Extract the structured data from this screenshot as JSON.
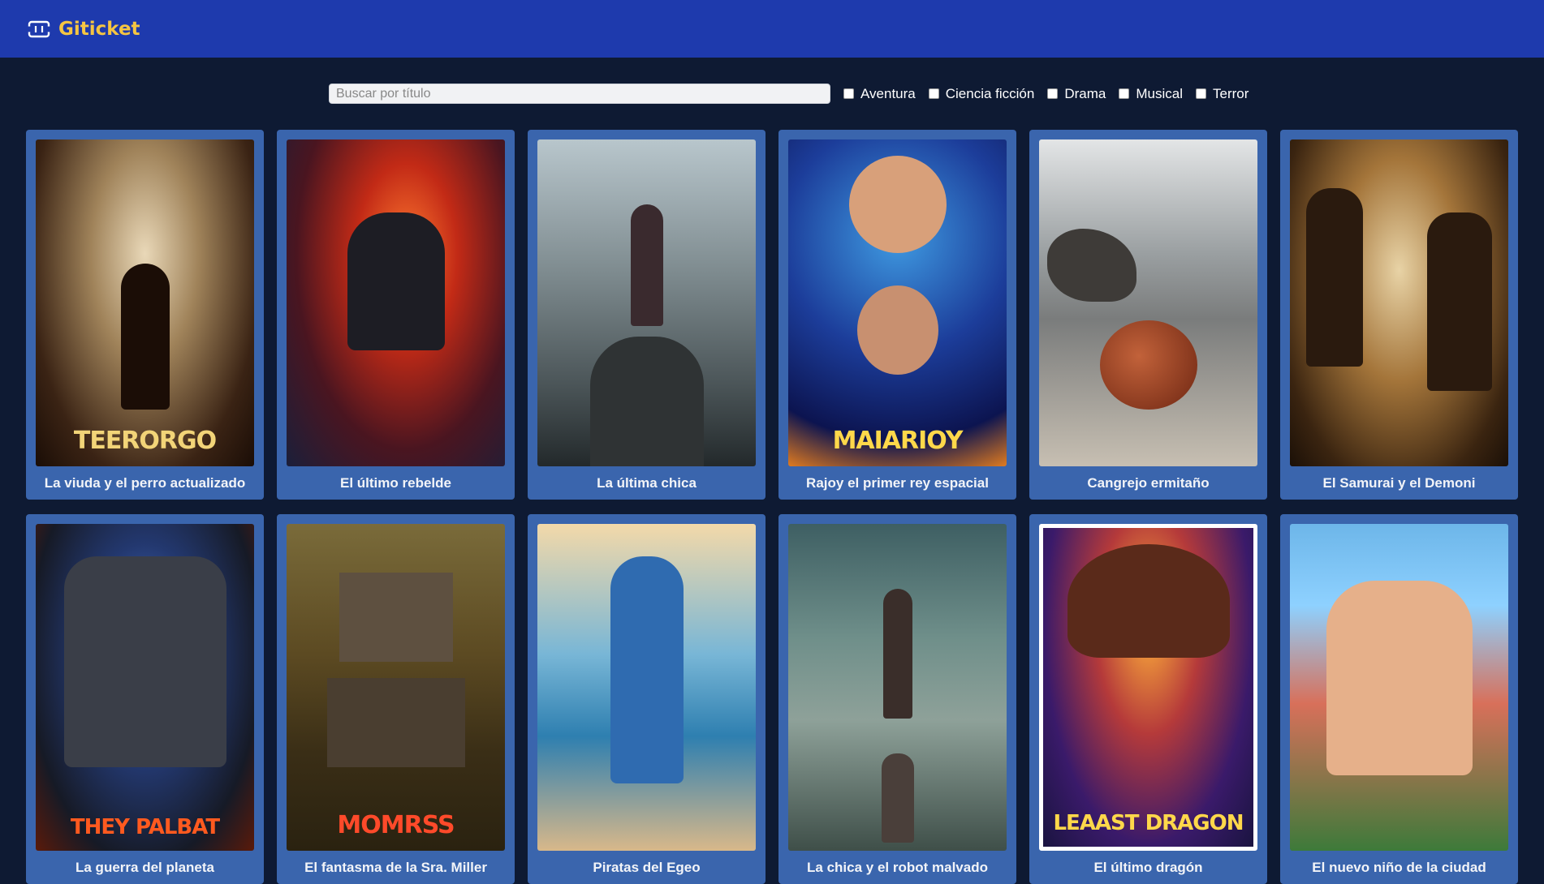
{
  "app": {
    "name": "Giticket"
  },
  "search": {
    "placeholder": "Buscar por título"
  },
  "genres": [
    "Aventura",
    "Ciencia ficción",
    "Drama",
    "Musical",
    "Terror"
  ],
  "movies": [
    {
      "title": "La viuda y el perro actualizado",
      "poster_text": "TEERORGO",
      "poster_text_color": "#f2d478"
    },
    {
      "title": "El último rebelde",
      "poster_text": "",
      "poster_text_color": "#ffffff"
    },
    {
      "title": "La última chica",
      "poster_text": "",
      "poster_text_color": "#ffffff"
    },
    {
      "title": "Rajoy el primer rey espacial",
      "poster_text": "MAIARIOY",
      "poster_text_color": "#ffd84a"
    },
    {
      "title": "Cangrejo ermitaño",
      "poster_text": "",
      "poster_text_color": "#ffffff"
    },
    {
      "title": "El Samurai y el Demoni",
      "poster_text": "",
      "poster_text_color": "#ffffff"
    },
    {
      "title": "La guerra del planeta",
      "poster_text": "THEY PALBAT",
      "poster_text_color": "#ff5a1f"
    },
    {
      "title": "El fantasma de la Sra. Miller",
      "poster_text": "MOMRSS",
      "poster_text_color": "#ff4a2a"
    },
    {
      "title": "Piratas del Egeo",
      "poster_text": "",
      "poster_text_color": "#ffffff"
    },
    {
      "title": "La chica y el robot malvado",
      "poster_text": "",
      "poster_text_color": "#ffffff"
    },
    {
      "title": "El último dragón",
      "poster_text": "LEAAST DRAGON",
      "poster_text_color": "#ffd84a"
    },
    {
      "title": "El nuevo niño de la ciudad",
      "poster_text": "",
      "poster_text_color": "#ffffff"
    }
  ],
  "colors": {
    "header": "#1e3aad",
    "background": "#0e1a33",
    "card": "#3a65ad",
    "accent": "#f5c542"
  }
}
